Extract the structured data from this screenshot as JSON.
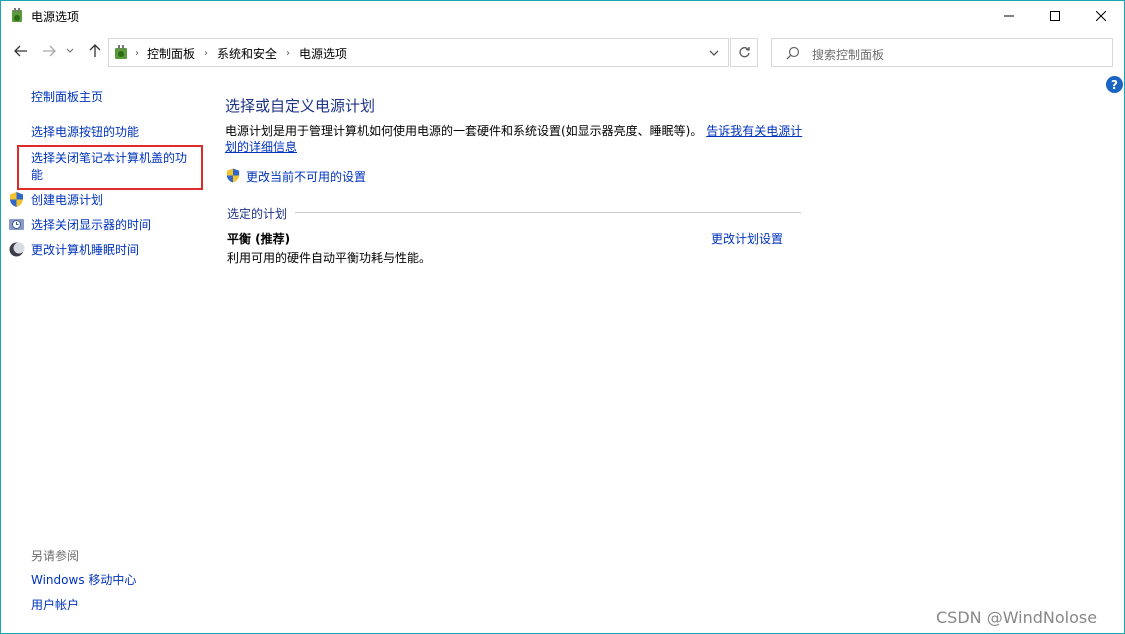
{
  "window": {
    "title": "电源选项",
    "app_icon": "power-options-icon"
  },
  "nav": {
    "breadcrumbs": [
      "控制面板",
      "系统和安全",
      "电源选项"
    ],
    "search_placeholder": "搜索控制面板"
  },
  "sidebar": {
    "home": "控制面板主页",
    "items": [
      {
        "label": "选择电源按钮的功能",
        "icon": null
      },
      {
        "label_line1": "选择关闭笔记本计算机盖的功",
        "label_line2": "能",
        "icon": null
      },
      {
        "label": "创建电源计划",
        "icon": "shield-icon"
      },
      {
        "label": "选择关闭显示器的时间",
        "icon": "display-clock-icon"
      },
      {
        "label": "更改计算机睡眠时间",
        "icon": "sleep-moon-icon"
      }
    ],
    "see_also_heading": "另请参阅",
    "see_also": [
      "Windows 移动中心",
      "用户帐户"
    ]
  },
  "main": {
    "title": "选择或自定义电源计划",
    "description": "电源计划是用于管理计算机如何使用电源的一套硬件和系统设置(如显示器亮度、睡眠等)。",
    "learn_more_line1": "告诉我有关电源计",
    "learn_more_line2": "划的详细信息",
    "change_unavailable": "更改当前不可用的设置",
    "selected_plan_heading": "选定的计划",
    "plan": {
      "name": "平衡 (推荐)",
      "description": "利用可用的硬件自动平衡功耗与性能。",
      "settings_link": "更改计划设置"
    }
  },
  "watermark": "CSDN @WindNolose",
  "colors": {
    "link": "#0033bc",
    "heading": "#1e3287",
    "highlight_border": "#e02b2b",
    "window_border": "#1aa5b6"
  }
}
